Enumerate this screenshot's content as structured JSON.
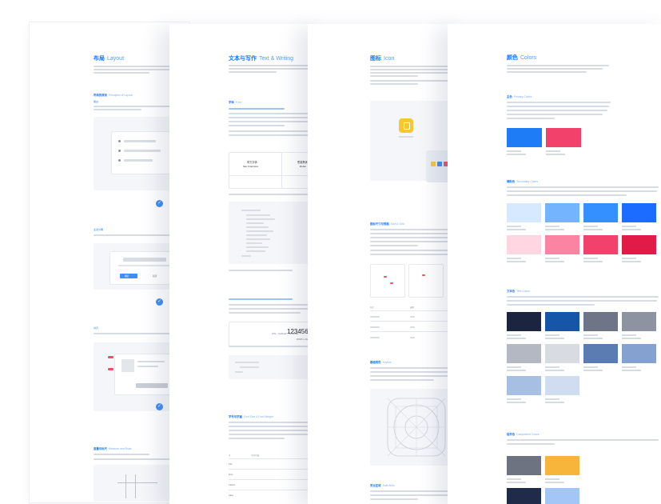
{
  "sheet1": {
    "title": "布局",
    "title_en": "Layout",
    "section_principles": "布局的原则",
    "section_principles_en": "Principles of Layout",
    "sub_1": "留白",
    "sub_2": "主次分明",
    "sub_3": "对齐",
    "button_primary": "确定",
    "button_secondary": "取消",
    "section_measure": "度量与标尺",
    "section_measure_en": "Measure and Ruler"
  },
  "sheet2": {
    "title": "文本与写作",
    "title_en": "Text & Writing",
    "section_font": "字体",
    "section_font_en": "Font",
    "font_name_1": "苹方字体",
    "font_name_1_en": "San Francisco",
    "font_name_2": "思源黑体",
    "font_name_2_en": "Robot",
    "number_sample": "1234567",
    "number_font": "DINPro-Medium",
    "platforms": "iOS、Android、Windows",
    "section_size": "字号与字重",
    "section_size_en": "Font Size & Font Weight",
    "table_header": "字号/行高",
    "rows": [
      "Title",
      "Body",
      "Caption",
      "Label"
    ]
  },
  "sheet3": {
    "title": "图标",
    "title_en": "Icon",
    "section_size": "图标尺寸与规格",
    "section_size_en": "Size & Grid",
    "section_shape": "栅格规范",
    "section_shape_en": "Keyline",
    "section_safe": "安全区域",
    "section_safe_en": "Safe Area"
  },
  "sheet4": {
    "title": "颜色",
    "title_en": "Colors",
    "section_primary": "主色",
    "section_primary_en": "Primary Colors",
    "section_secondary": "辅助色",
    "section_secondary_en": "Secondary Colors",
    "section_text": "文本色",
    "section_text_en": "Text Colors",
    "section_component": "组件色",
    "section_component_en": "Component Colors",
    "primary_swatches": [
      "#1f7cf7",
      "#f2416b"
    ],
    "secondary_swatches": [
      "#d6e9ff",
      "#74b4ff",
      "#3590ff",
      "#1c6dff",
      "#ffd6e1",
      "#fa84a2",
      "#f2416b",
      "#e11b48"
    ],
    "text_swatches": [
      "#1b2540",
      "#1556a8",
      "#6e7587",
      "#8d93a1",
      "#b3b8c3",
      "#d8dbe1",
      "#5b7cb2",
      "#84a1d0",
      "#a8bfe4",
      "#d0ddf1"
    ],
    "component_swatches": [
      "#6e7382",
      "#f7b53b",
      "#1f2b49",
      "#a4c6f7"
    ]
  }
}
